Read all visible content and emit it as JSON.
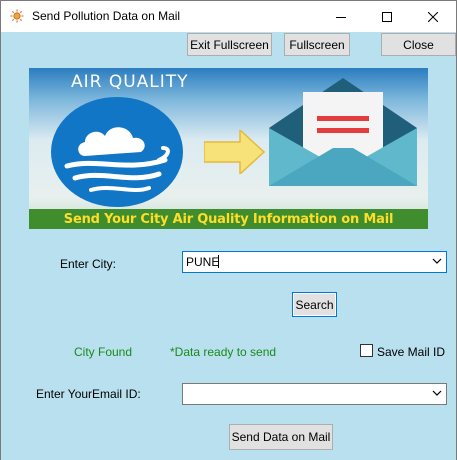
{
  "window": {
    "title": "Send Pollution Data on Mail",
    "app_icon": "gear-sun-icon",
    "controls": {
      "minimize": "minimize-icon",
      "maximize": "maximize-icon",
      "close": "close-icon"
    }
  },
  "toolbar": {
    "exit_fullscreen_label": "Exit Fullscreen",
    "fullscreen_label": "Fullscreen",
    "close_label": "Close"
  },
  "banner": {
    "headline": "AIR QUALITY",
    "tagline": "Send Your City Air Quality Information on Mail",
    "icons": [
      "cloud-wind-icon",
      "arrow-right-icon",
      "envelope-letter-icon"
    ]
  },
  "form": {
    "city_label": "Enter City:",
    "city_value": "PUNE",
    "search_label": "Search",
    "status_city": "City Found",
    "status_data": "*Data ready to send",
    "save_mail_label": "Save Mail ID",
    "save_mail_checked": false,
    "email_label": "Enter YourEmail ID:",
    "email_value": "",
    "send_label": "Send Data on Mail"
  },
  "colors": {
    "client_bg": "#b9e0ee",
    "status_green": "#1a8a1a",
    "banner_strip": "#3f8d2d",
    "banner_text": "#ffdd2b"
  }
}
